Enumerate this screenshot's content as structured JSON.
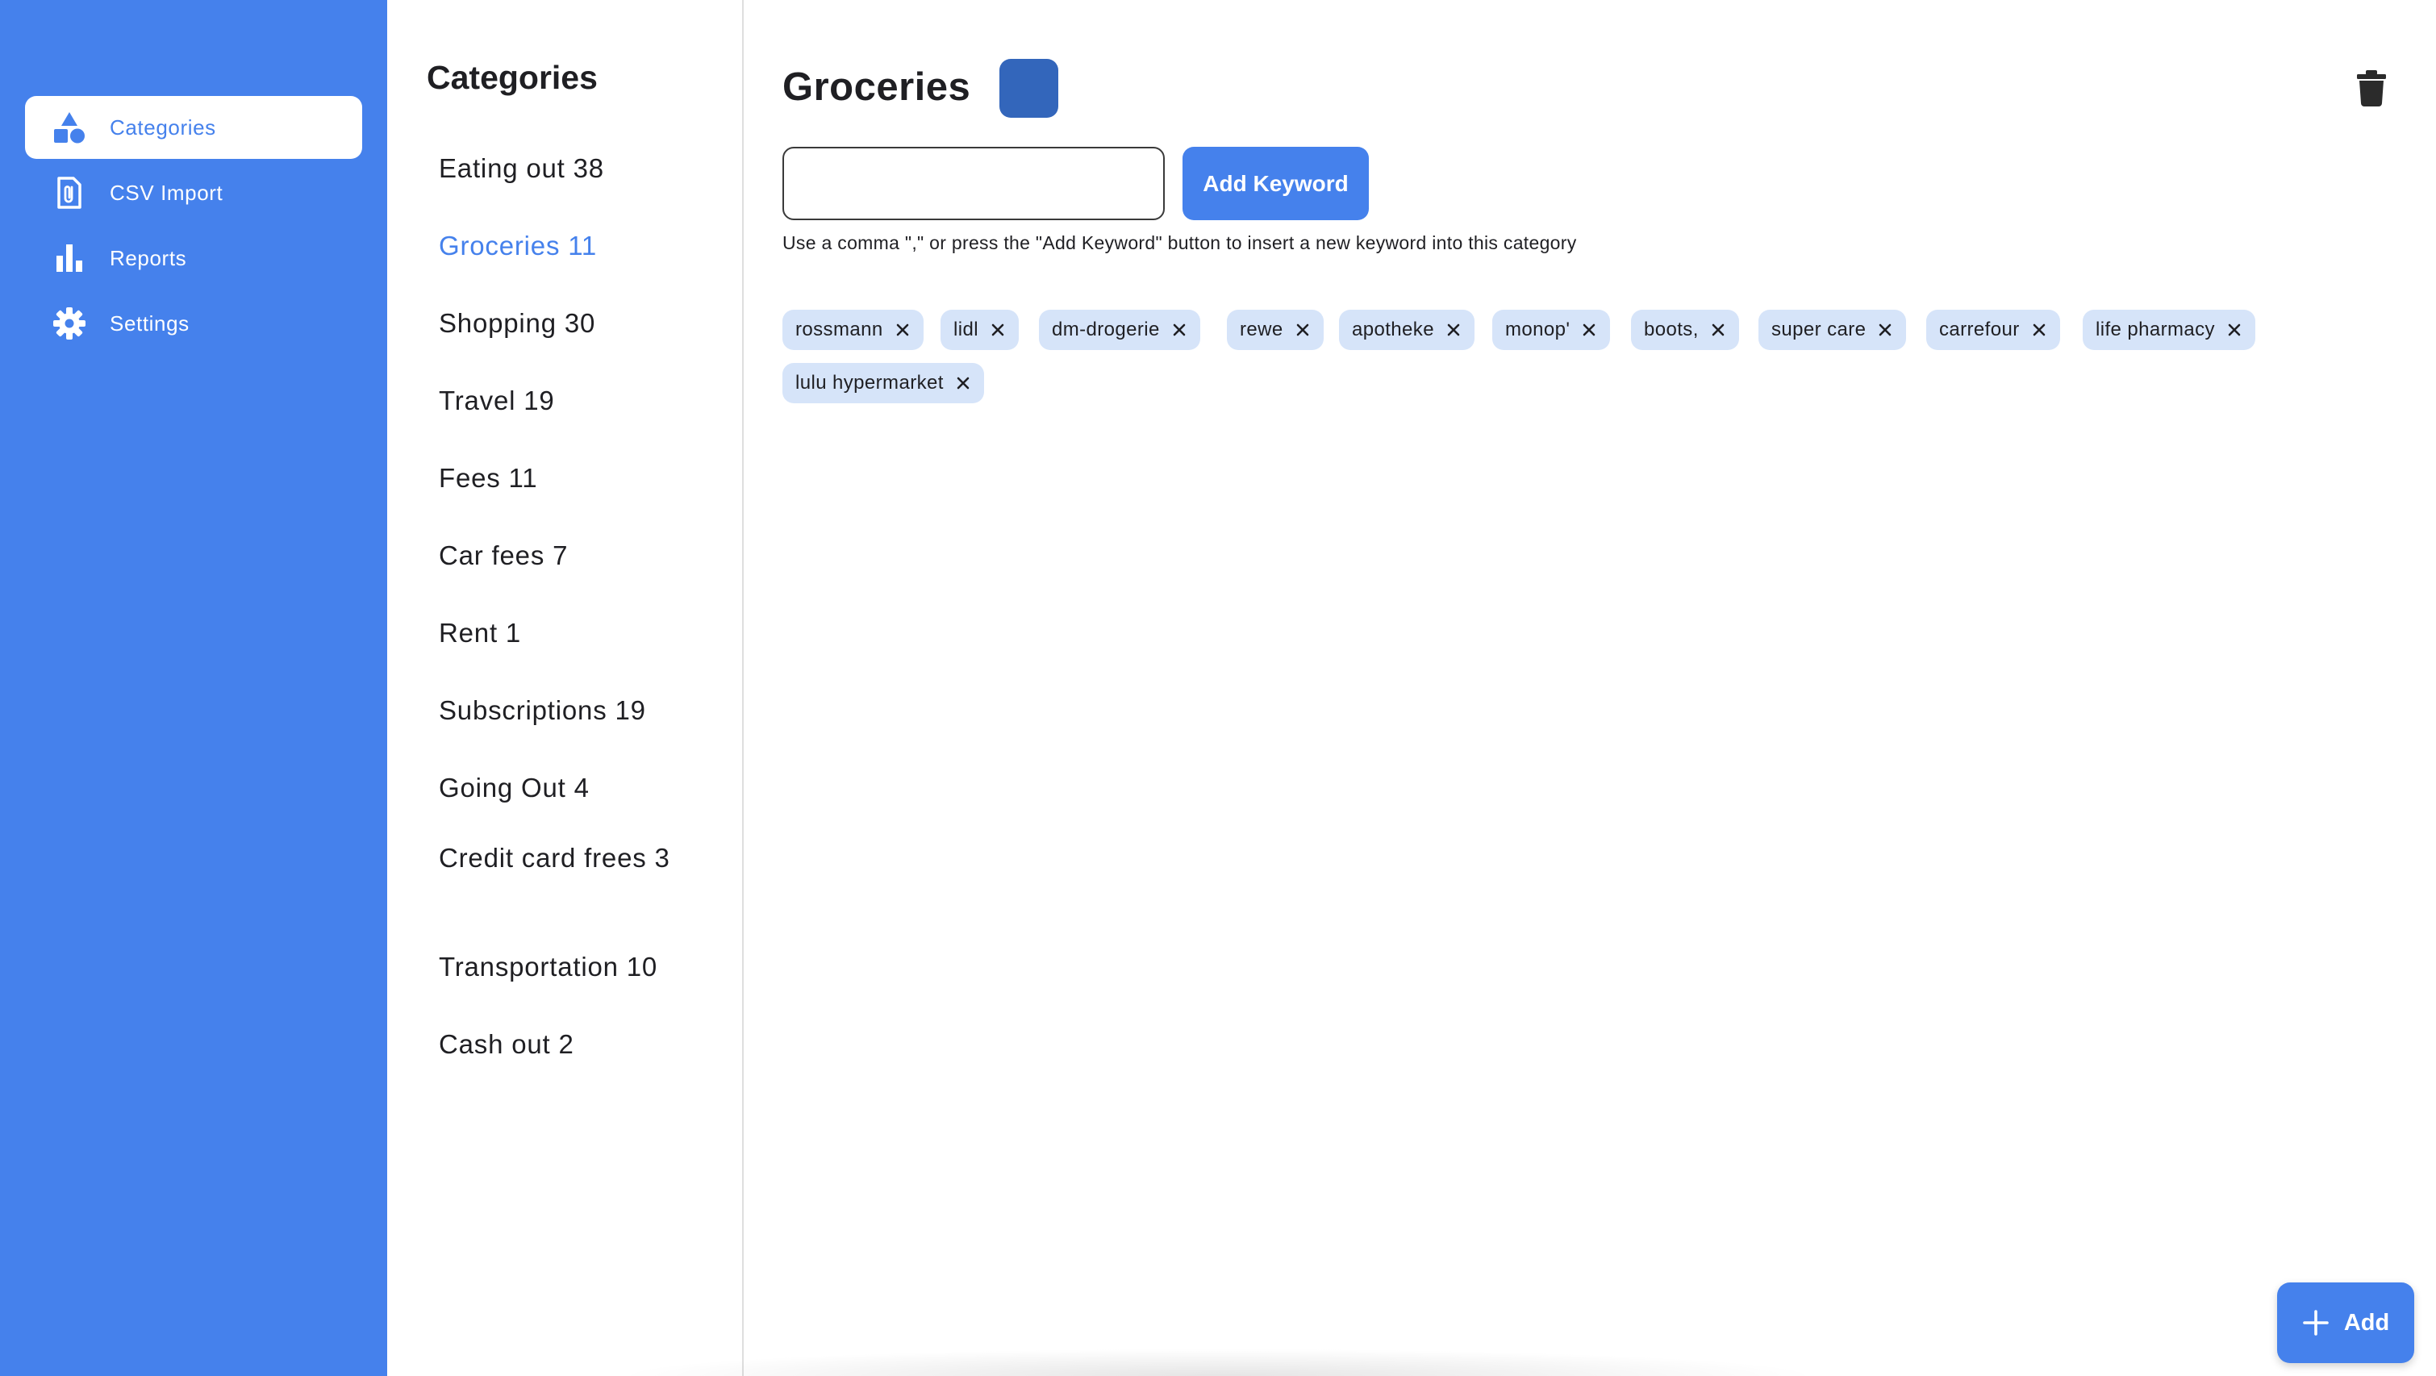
{
  "nav": {
    "items": [
      {
        "label": "Categories",
        "icon": "shapes-icon",
        "active": true
      },
      {
        "label": "CSV Import",
        "icon": "file-attachment-icon",
        "active": false
      },
      {
        "label": "Reports",
        "icon": "bar-chart-icon",
        "active": false
      },
      {
        "label": "Settings",
        "icon": "gear-icon",
        "active": false
      }
    ]
  },
  "categories": {
    "heading": "Categories",
    "items": [
      {
        "label": "Eating out 38",
        "selected": false
      },
      {
        "label": "Groceries 11",
        "selected": true
      },
      {
        "label": "Shopping 30",
        "selected": false
      },
      {
        "label": "Travel 19",
        "selected": false
      },
      {
        "label": "Fees 11",
        "selected": false
      },
      {
        "label": "Car fees 7",
        "selected": false
      },
      {
        "label": "Rent 1",
        "selected": false
      },
      {
        "label": "Subscriptions 19",
        "selected": false
      },
      {
        "label": "Going Out 4",
        "selected": false
      },
      {
        "label": "Credit card frees 3",
        "selected": false
      },
      {
        "label": "Transportation 10",
        "selected": false
      },
      {
        "label": "Cash out 2",
        "selected": false
      }
    ]
  },
  "detail": {
    "title": "Groceries",
    "color": "#3366bb",
    "keyword_input": {
      "value": "",
      "placeholder": ""
    },
    "add_keyword_label": "Add Keyword",
    "hint": "Use a comma \",\" or press the \"Add Keyword\" button to insert a new keyword into this category",
    "keywords": [
      "rossmann",
      "lidl",
      "dm-drogerie",
      "rewe",
      "apotheke",
      "monop'",
      "boots,",
      "super care",
      "carrefour",
      "life pharmacy",
      "lulu hypermarket"
    ]
  },
  "fab": {
    "label": "Add"
  },
  "colors": {
    "accent": "#4581ec",
    "tag_bg": "#d6e4f9",
    "text": "#1f1f23"
  }
}
